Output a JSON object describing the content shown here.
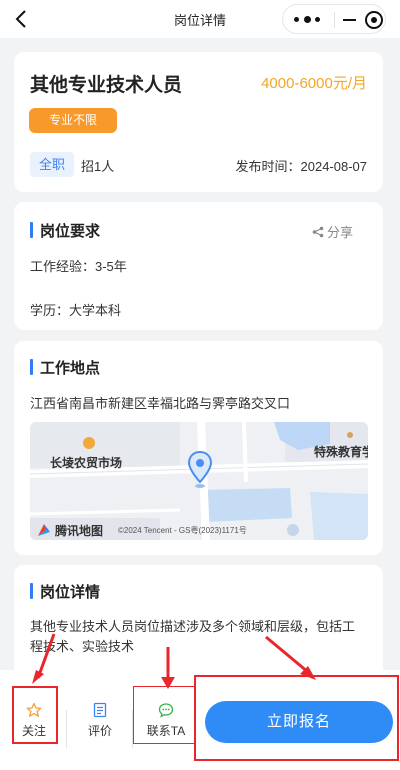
{
  "nav": {
    "title": "岗位详情"
  },
  "job": {
    "title": "其他专业技术人员",
    "salary": "4000-6000元/月",
    "major_tag": "专业不限",
    "type_tag": "全职",
    "hire_count": "招1人",
    "publish_time": "发布时间：2024-08-07"
  },
  "requirements": {
    "title": "岗位要求",
    "share_label": "分享",
    "experience": "工作经验：3-5年",
    "education": "学历：大学本科"
  },
  "location": {
    "title": "工作地点",
    "address": "江西省南昌市新建区幸福北路与霁亭路交叉口",
    "map": {
      "poi_market": "长堎农贸市场",
      "poi_school": "特殊教育学",
      "logo": "腾讯地图",
      "copyright": "©2024 Tencent - GS粤(2023)1171号"
    }
  },
  "details": {
    "title": "岗位详情",
    "description": "其他专业技术人员岗位描述涉及多个领域和层级，包括工程技术、实验技术"
  },
  "toolbar": {
    "follow_label": "关注",
    "review_label": "评价",
    "contact_label": "联系TA",
    "apply_label": "立即报名"
  },
  "colors": {
    "accent": "#2f8cf6",
    "salary": "#f5a623",
    "tag": "#f79a2b",
    "annotation": "#e8262b"
  }
}
